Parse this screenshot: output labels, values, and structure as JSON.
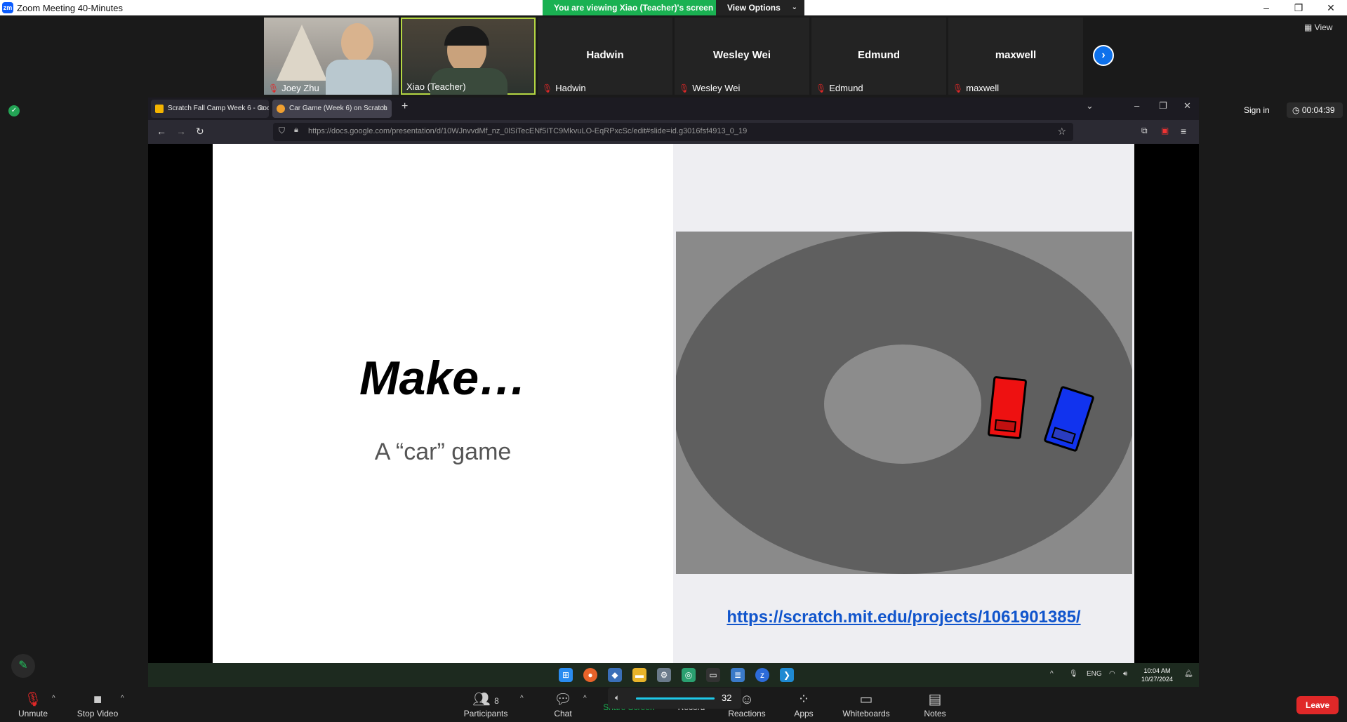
{
  "window": {
    "title": "Zoom Meeting 40-Minutes",
    "minimize": "–",
    "restore": "❐",
    "close": "✕"
  },
  "banner": {
    "text": "You are viewing Xiao (Teacher)'s screen",
    "view_options": "View Options"
  },
  "gallery": {
    "participants": [
      {
        "name": "Joey Zhu",
        "label": "Joey Zhu",
        "video": true
      },
      {
        "name": "Xiao (Teacher)",
        "label": "Xiao (Teacher)",
        "video": true
      },
      {
        "name": "Hadwin",
        "label": "Hadwin",
        "video": false
      },
      {
        "name": "Wesley Wei",
        "label": "Wesley Wei",
        "video": false
      },
      {
        "name": "Edmund",
        "label": "Edmund",
        "video": false
      },
      {
        "name": "maxwell",
        "label": "maxwell",
        "video": false
      }
    ],
    "view_label": "View"
  },
  "meeting": {
    "sign_in": "Sign in",
    "timer": "00:04:39"
  },
  "browser": {
    "tabs": [
      {
        "label": "Scratch Fall Camp Week 6 - Goo",
        "active": false
      },
      {
        "label": "Car Game (Week 6) on Scratch",
        "active": true
      }
    ],
    "url": "https://docs.google.com/presentation/d/10WJnvvdMf_nz_0lSiTecENf5ITC9MkvuLO-EqRPxcSc/edit#slide=id.g3016fsf4913_0_19"
  },
  "slide": {
    "title": "Make…",
    "subtitle": "A “car” game",
    "link": "https://scratch.mit.edu/projects/1061901385/"
  },
  "taskbar": {
    "lang": "ENG",
    "time": "10:04 AM",
    "date": "10/27/2024"
  },
  "toolbar": {
    "unmute": "Unmute",
    "stop_video": "Stop Video",
    "participants": "Participants",
    "participants_count": "8",
    "chat": "Chat",
    "share_screen": "Share Screen",
    "record": "Record",
    "reactions": "Reactions",
    "apps": "Apps",
    "whiteboards": "Whiteboards",
    "notes": "Notes",
    "leave": "Leave",
    "volume": "32"
  },
  "colors": {
    "banner_green": "#1ab152",
    "leave_red": "#e02828",
    "zoom_blue": "#0e71eb",
    "link_blue": "#1155cc",
    "red_car": "#ee1111",
    "blue_car": "#1133ee"
  }
}
